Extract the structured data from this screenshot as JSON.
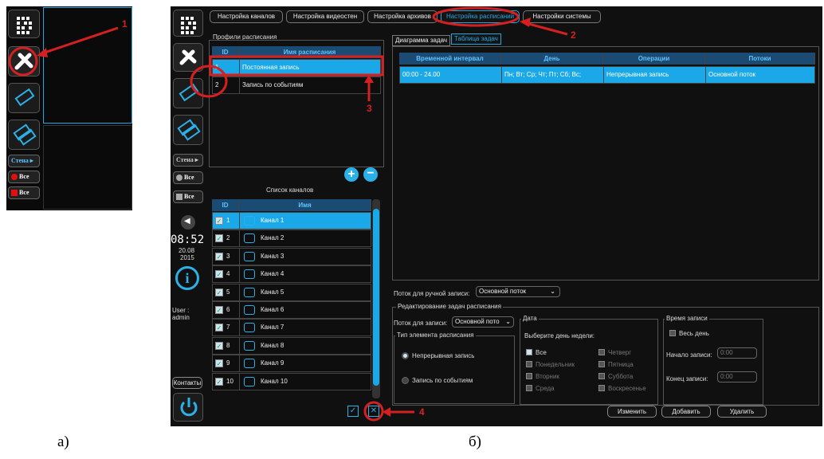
{
  "panel_a": {
    "wall_label": "Стена ▸",
    "rec_all_label": "Все",
    "stop_all_label": "Все"
  },
  "panel_b": {
    "side": {
      "wall_label": "Стена ▸",
      "all_label_1": "Все",
      "all_label_2": "Все",
      "time": "08:52",
      "date_day": "20.08",
      "date_year": "2015",
      "user_label": "User :",
      "user_name": "admin",
      "contacts_label": "Контакты"
    },
    "top_tabs": [
      "Настройка каналов",
      "Настройка видеостен",
      "Настройка архивов",
      "Настройка расписаний",
      "Настройки системы"
    ],
    "profiles": {
      "title": "Профили расписания",
      "col_id": "ID",
      "col_name": "Имя расписания",
      "rows": [
        {
          "id": "1",
          "name": "Постоянная запись"
        },
        {
          "id": "2",
          "name": "Запись по событиям"
        }
      ]
    },
    "channels": {
      "title": "Список каналов",
      "col_id": "ID",
      "col_name": "Имя",
      "rows": [
        {
          "id": "1",
          "name": "Канал 1"
        },
        {
          "id": "2",
          "name": "Канал 2"
        },
        {
          "id": "3",
          "name": "Канал 3"
        },
        {
          "id": "4",
          "name": "Канал 4"
        },
        {
          "id": "5",
          "name": "Канал 5"
        },
        {
          "id": "6",
          "name": "Канал 6"
        },
        {
          "id": "7",
          "name": "Канал 7"
        },
        {
          "id": "8",
          "name": "Канал 8"
        },
        {
          "id": "9",
          "name": "Канал 9"
        },
        {
          "id": "10",
          "name": "Канал 10"
        }
      ]
    },
    "task_tabs": [
      "Диаграмма задач",
      "Таблица задач"
    ],
    "tasks": {
      "columns": [
        "Временной интервал",
        "День",
        "Операции",
        "Потоки"
      ],
      "row": [
        "00:00 - 24.00",
        "Пн; Вт; Ср; Чт; Пт; Сб; Вс;",
        "Непрерывная запись",
        "Основной поток"
      ]
    },
    "manual_stream_label": "Поток для ручной записи:",
    "manual_stream_value": "Основной поток",
    "edit_group_title": "Редактирование задач расписания",
    "stream_label": "Поток для записи:",
    "stream_value": "Основной пото",
    "element_type_title": "Тип элемента расписания",
    "type_continuous": "Непрерывная запись",
    "type_events": "Запись по событиям",
    "date_title": "Дата",
    "choose_day": "Выберите день недели:",
    "days": {
      "all": "Все",
      "mon": "Понедельник",
      "tue": "Вторник",
      "wed": "Среда",
      "thu": "Четверг",
      "fri": "Пятница",
      "sat": "Суббота",
      "sun": "Воскресенье"
    },
    "rec_time_title": "Время записи",
    "all_day": "Весь день",
    "start_label": "Начало записи:",
    "start_value": "0:00",
    "end_label": "Конец записи:",
    "end_value": "0:00",
    "buttons": {
      "change": "Изменить",
      "add": "Добавить",
      "delete": "Удалить"
    }
  },
  "annotations": [
    "1",
    "2",
    "3",
    "4"
  ],
  "captions": {
    "a": "а)",
    "b": "б)"
  },
  "colors": {
    "accent": "#22a8e0",
    "selected_row": "#1aa8e8",
    "annotation": "#d42020"
  }
}
